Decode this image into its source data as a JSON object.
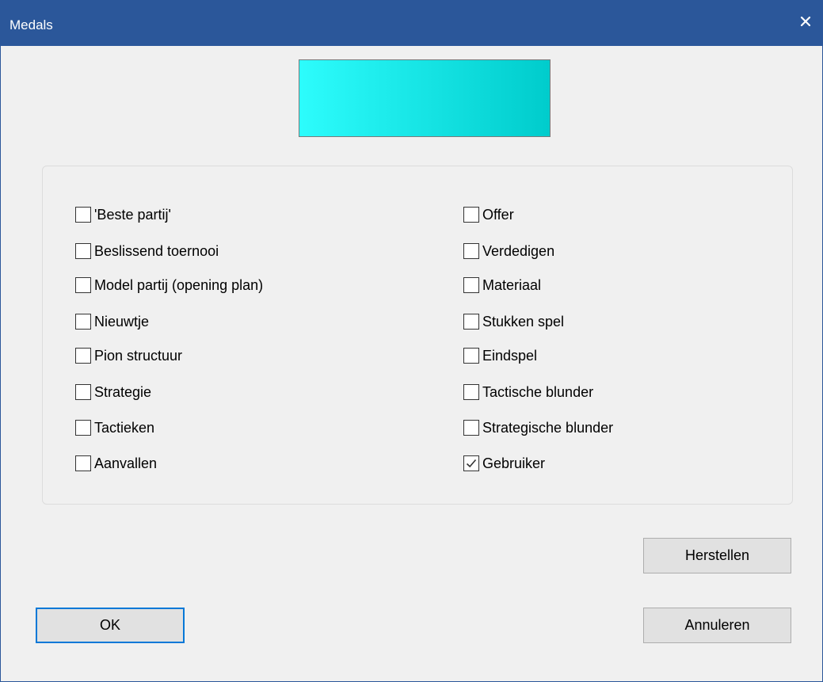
{
  "window": {
    "title": "Medals"
  },
  "swatch": {
    "color_start": "#2dfcfc",
    "color_end": "#00cccc"
  },
  "checkboxes": {
    "left": [
      {
        "label": "'Beste partij'",
        "checked": false
      },
      {
        "label": "Beslissend toernooi",
        "checked": false
      },
      {
        "label": "Model partij (opening plan)",
        "checked": false
      },
      {
        "label": "Nieuwtje",
        "checked": false
      },
      {
        "label": "Pion structuur",
        "checked": false
      },
      {
        "label": "Strategie",
        "checked": false
      },
      {
        "label": "Tactieken",
        "checked": false
      },
      {
        "label": "Aanvallen",
        "checked": false
      }
    ],
    "right": [
      {
        "label": "Offer",
        "checked": false
      },
      {
        "label": "Verdedigen",
        "checked": false
      },
      {
        "label": "Materiaal",
        "checked": false
      },
      {
        "label": "Stukken spel",
        "checked": false
      },
      {
        "label": "Eindspel",
        "checked": false
      },
      {
        "label": "Tactische blunder",
        "checked": false
      },
      {
        "label": "Strategische blunder",
        "checked": false
      },
      {
        "label": "Gebruiker",
        "checked": true
      }
    ]
  },
  "buttons": {
    "restore": "Herstellen",
    "ok": "OK",
    "cancel": "Annuleren"
  },
  "colors": {
    "titlebar": "#2b579a",
    "focus_border": "#0078d7"
  }
}
